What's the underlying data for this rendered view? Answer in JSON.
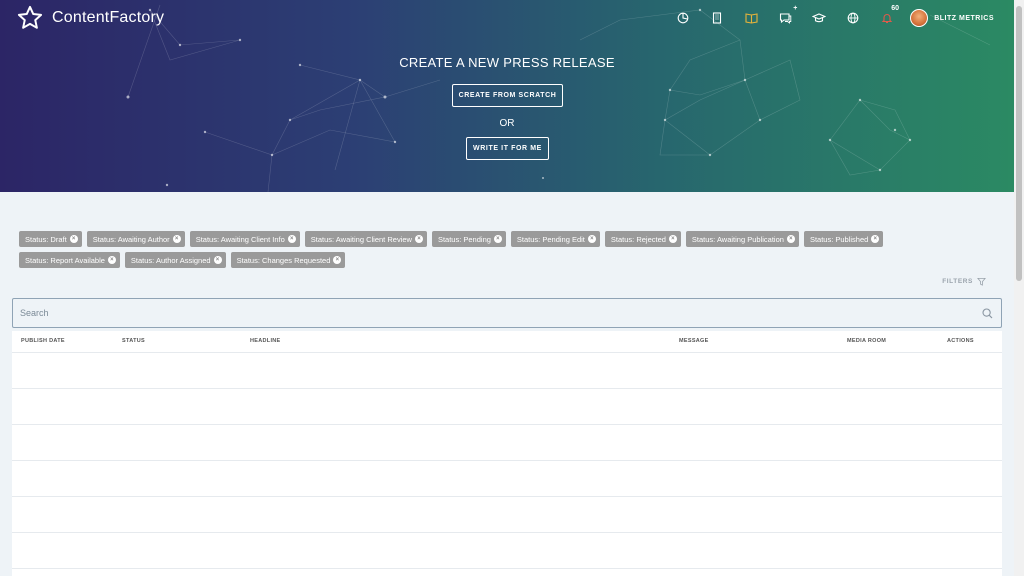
{
  "brand": {
    "name": "ContentFactory"
  },
  "topnav": {
    "messages_badge": "+",
    "notifications_count": "60",
    "user_name": "BLITZ METRICS"
  },
  "hero": {
    "title": "CREATE A NEW PRESS RELEASE",
    "scratch_label": "CREATE FROM SCRATCH",
    "or_label": "OR",
    "write_label": "WRITE IT FOR ME"
  },
  "filters": {
    "chips": [
      "Status: Draft",
      "Status: Awaiting Author",
      "Status: Awaiting Client Info",
      "Status: Awaiting Client Review",
      "Status: Pending",
      "Status: Pending Edit",
      "Status: Rejected",
      "Status: Awaiting Publication",
      "Status: Published",
      "Status: Report Available",
      "Status: Author Assigned",
      "Status: Changes Requested"
    ],
    "filters_label": "FILTERS"
  },
  "search": {
    "placeholder": "Search"
  },
  "table": {
    "columns": [
      "PUBLISH DATE",
      "STATUS",
      "HEADLINE",
      "MESSAGE",
      "MEDIA ROOM",
      "ACTIONS"
    ]
  },
  "colors": {
    "accent_book": "#e8b43a",
    "notification": "#e05a4a"
  }
}
